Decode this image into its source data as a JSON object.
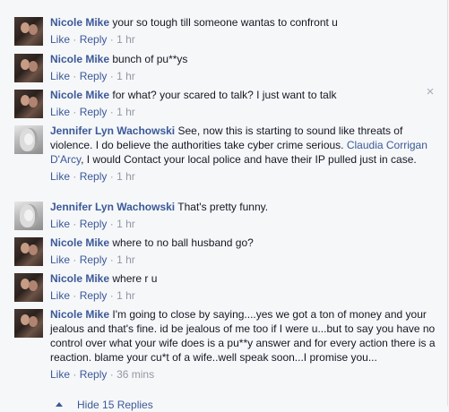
{
  "actions": {
    "like": "Like",
    "reply": "Reply",
    "separator": "·"
  },
  "comments": [
    {
      "author": "Nicole Mike",
      "avatar": "nicole-profile-photo",
      "text": "your so tough till someone wantas to confront u",
      "time": "1 hr"
    },
    {
      "author": "Nicole Mike",
      "avatar": "nicole-profile-photo",
      "text": "bunch of pu**ys",
      "time": "1 hr"
    },
    {
      "author": "Nicole Mike",
      "avatar": "nicole-profile-photo",
      "text": "for what? your scared to talk? I just want to talk",
      "time": "1 hr"
    },
    {
      "author": "Jennifer Lyn Wachowski",
      "avatar": "jennifer-profile-photo",
      "text_before": "See, now this is starting to sound like threats of violence. I do believe the authorities take cyber crime serious.",
      "mention": "Claudia Corrigan D'Arcy",
      "text_after": ", I would Contact your local police and have their IP pulled just in case.",
      "time": "1 hr"
    },
    {
      "author": "Jennifer Lyn Wachowski",
      "avatar": "jennifer-profile-photo",
      "text": "That's pretty funny.",
      "time": "1 hr"
    },
    {
      "author": "Nicole Mike",
      "avatar": "nicole-profile-photo",
      "text": "where to no ball husband go?",
      "time": "1 hr"
    },
    {
      "author": "Nicole Mike",
      "avatar": "nicole-profile-photo",
      "text": "where r u",
      "time": "1 hr"
    },
    {
      "author": "Nicole Mike",
      "avatar": "nicole-profile-photo",
      "text": "I'm going to close by saying....yes we got a ton of money and your jealous and that's fine. id be jealous of me too if I were u...but to say you have no control over what your wife does is a pu**y answer and for every action there is a reaction. blame your cu*t of a wife..well speak soon...I promise you...",
      "time": "36 mins"
    }
  ],
  "close_icon": "×",
  "hide_replies": "Hide 15 Replies"
}
